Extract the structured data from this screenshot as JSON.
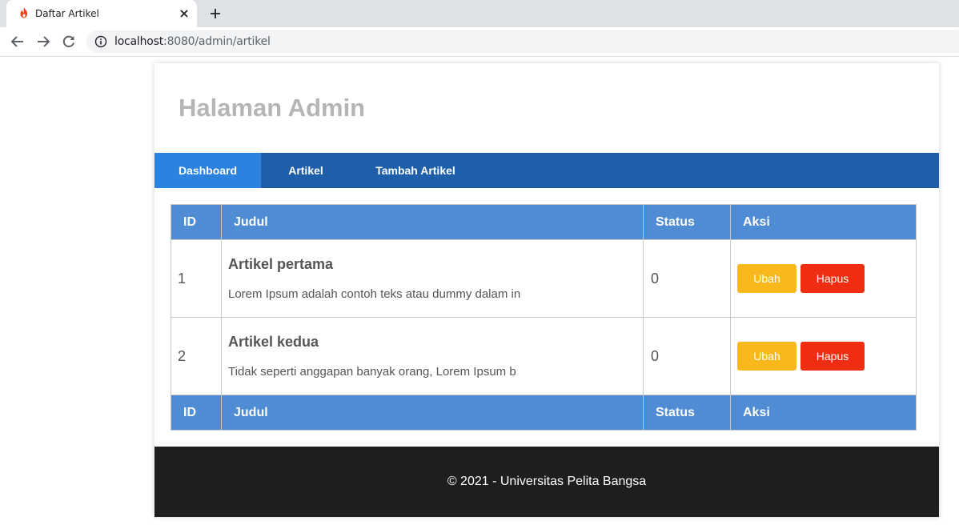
{
  "browser": {
    "tab_title": "Daftar Artikel",
    "url_host": "localhost",
    "url_rest": ":8080/admin/artikel"
  },
  "header": {
    "title": "Halaman Admin"
  },
  "nav": {
    "items": [
      {
        "label": "Dashboard",
        "active": true
      },
      {
        "label": "Artikel",
        "active": false
      },
      {
        "label": "Tambah Artikel",
        "active": false
      }
    ]
  },
  "table": {
    "headers": [
      "ID",
      "Judul",
      "Status",
      "Aksi"
    ],
    "rows": [
      {
        "id": "1",
        "title": "Artikel pertama",
        "excerpt": "Lorem Ipsum adalah contoh teks atau dummy dalam in",
        "status": "0",
        "edit_label": "Ubah",
        "delete_label": "Hapus"
      },
      {
        "id": "2",
        "title": "Artikel kedua",
        "excerpt": "Tidak seperti anggapan banyak orang, Lorem Ipsum b",
        "status": "0",
        "edit_label": "Ubah",
        "delete_label": "Hapus"
      }
    ]
  },
  "footer": {
    "text": "© 2021 - Universitas Pelita Bangsa"
  },
  "colors": {
    "nav_bg": "#1f5faa",
    "nav_active": "#2b83df",
    "table_header": "#4f8cd3",
    "btn_edit": "#f9b91d",
    "btn_delete": "#ef2d12",
    "footer_bg": "#1e1e1e"
  }
}
